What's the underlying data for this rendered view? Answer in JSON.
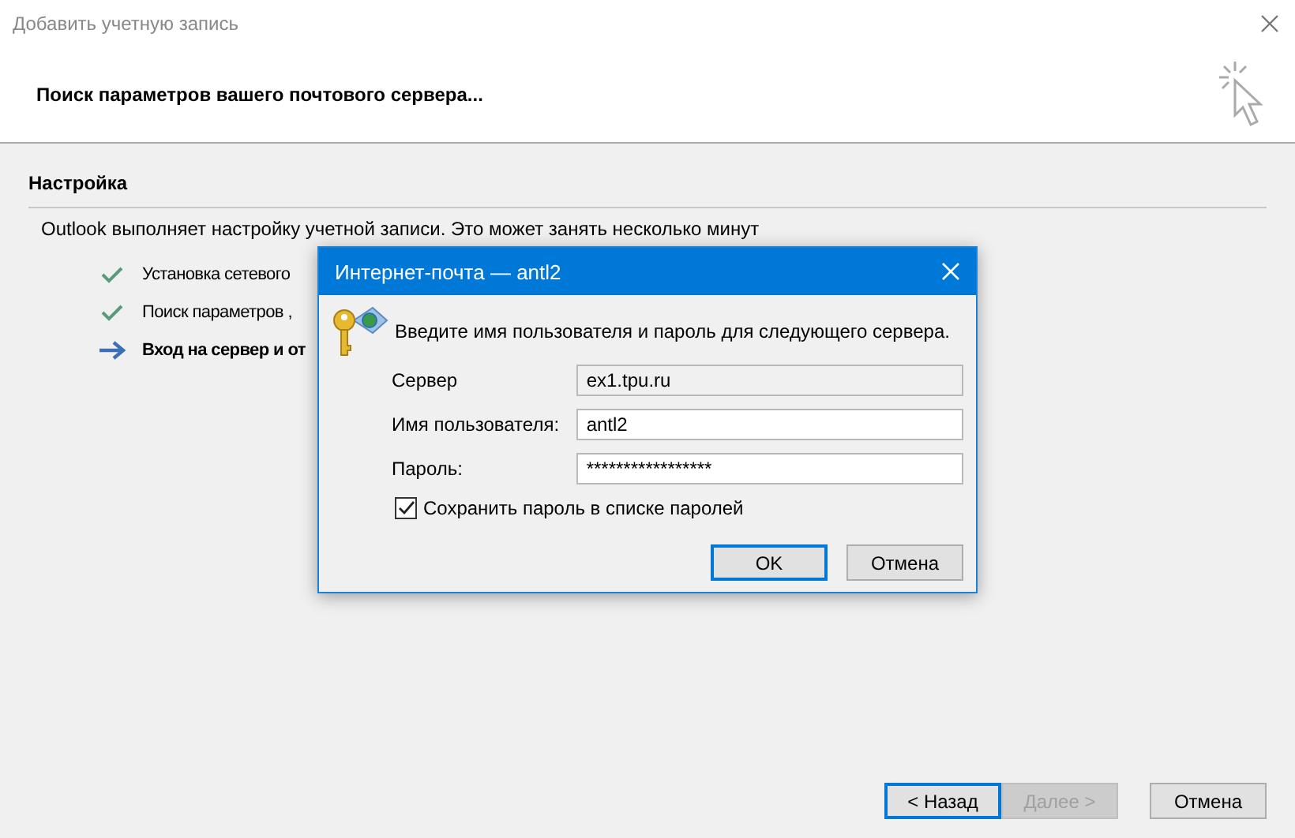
{
  "window": {
    "title": "Добавить учетную запись"
  },
  "header": {
    "heading": "Поиск параметров вашего почтового сервера..."
  },
  "section": {
    "title": "Настройка",
    "intro": "Outlook выполняет настройку учетной записи. Это может занять несколько минут",
    "steps": [
      {
        "label": "Установка сетевого",
        "kind": "done"
      },
      {
        "label": "Поиск параметров ,",
        "kind": "done"
      },
      {
        "label": "Вход на сервер и от",
        "kind": "current"
      }
    ]
  },
  "dialog": {
    "title": "Интернет-почта — antl2",
    "prompt": "Введите имя пользователя и пароль для следующего сервера.",
    "fields": [
      {
        "label": "Сервер",
        "value": "ex1.tpu.ru",
        "disabled": true
      },
      {
        "label": "Имя пользователя:",
        "value": "antl2",
        "disabled": false
      },
      {
        "label": "Пароль:",
        "value": "*****************",
        "disabled": false
      }
    ],
    "remember": {
      "label": "Сохранить пароль в списке паролей",
      "checked": true
    },
    "buttons": [
      {
        "label": "OK",
        "default": true
      },
      {
        "label": "Отмена",
        "default": false
      }
    ]
  },
  "buttons": [
    {
      "label": "< Назад",
      "default": true,
      "disabled": false
    },
    {
      "label": "Далее >",
      "default": false,
      "disabled": true
    },
    {
      "label": "Отмена",
      "default": false,
      "disabled": false
    }
  ]
}
